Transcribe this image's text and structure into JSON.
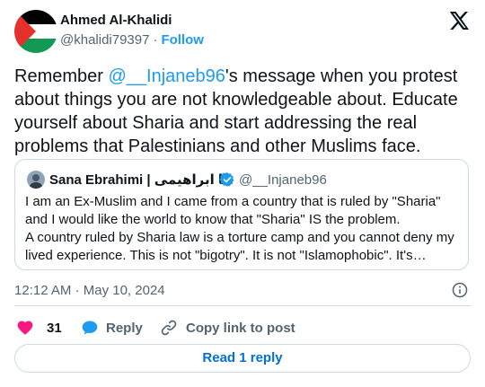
{
  "author": {
    "name": "Ahmed Al-Khalidi",
    "handle": "@khalidi79397",
    "separator": "·",
    "follow_label": "Follow",
    "avatar": "palestine-flag-avatar"
  },
  "tweet": {
    "text_before": "Remember ",
    "mention": "@__Injaneb96",
    "text_after": "'s message when you protest about things you are not knowledgeable about. Educate yourself about Sharia and start addressing the real problems that Palestinians and other Muslims face."
  },
  "quote": {
    "name": "Sana Ebrahimi | ثنا ابراهیمی",
    "handle": "@__Injaneb96",
    "verified": true,
    "text_line1": "I am an Ex-Muslim and I came from a country that is ruled by \"Sharia\" and I would like the world to know that \"Sharia\" IS the problem.",
    "text_line2": "A country ruled by Sharia law is a torture camp and you cannot deny my lived experience. This is not \"bigotry\". It is not \"Islamophobic\". It's…"
  },
  "meta": {
    "time": "12:12 AM",
    "separator": "·",
    "date": "May 10, 2024"
  },
  "actions": {
    "like_count": "31",
    "reply_label": "Reply",
    "copy_label": "Copy link to post"
  },
  "read_reply_label": "Read 1 reply",
  "colors": {
    "accent": "#1d9bf0",
    "like": "#f91880",
    "text": "#0f1419",
    "secondary": "#536471",
    "border": "#cfd9de",
    "read_reply": "#006fd6"
  }
}
